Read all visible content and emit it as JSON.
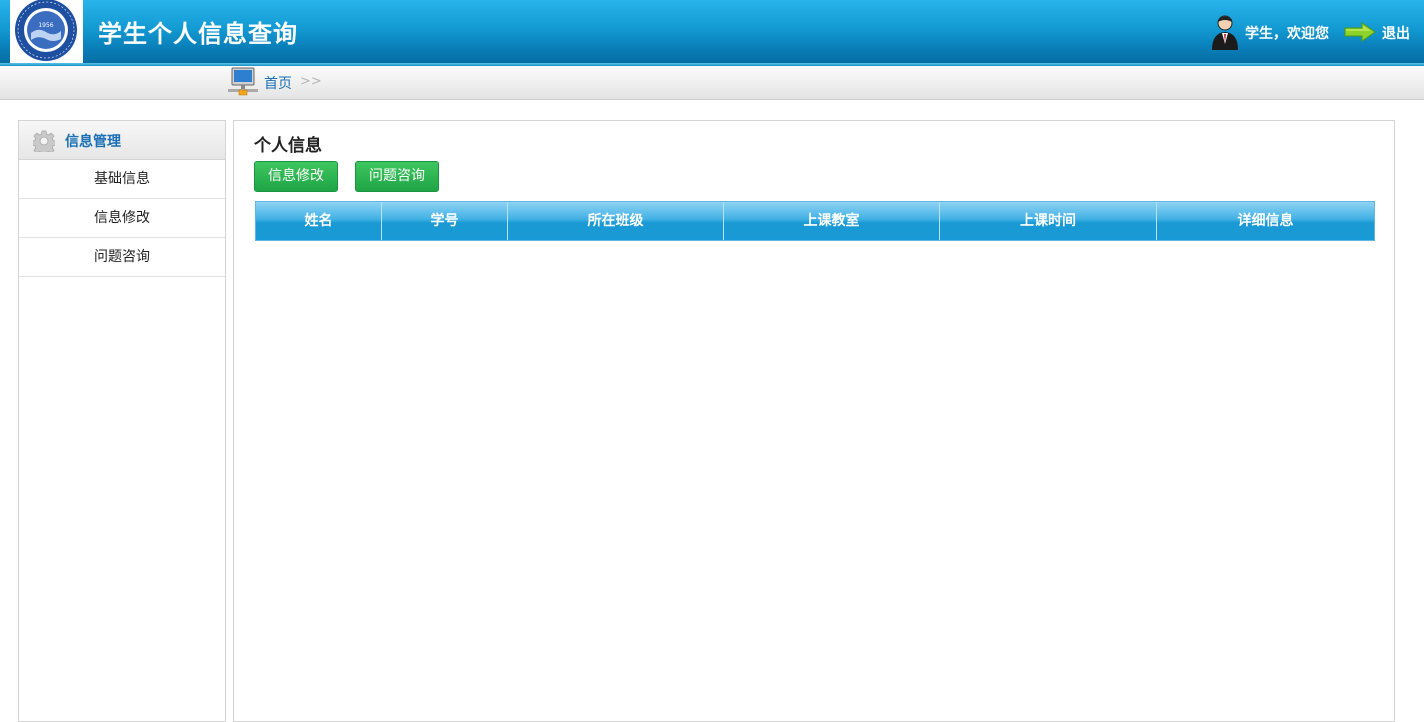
{
  "header": {
    "title": "学生个人信息查询",
    "logo_icon": "university-seal-icon",
    "welcome_text": "学生，欢迎您",
    "logout_label": "退出",
    "logo_text": "1956",
    "colors": {
      "header_blue": "#0a7fb9",
      "link_blue": "#1a6fb5",
      "button_green": "#22a94a"
    }
  },
  "breadcrumb": {
    "home": "首页",
    "separator": ">>"
  },
  "sidebar": {
    "section_title": "信息管理",
    "items": [
      {
        "label": "基础信息"
      },
      {
        "label": "信息修改"
      },
      {
        "label": "问题咨询"
      }
    ]
  },
  "main": {
    "title": "个人信息",
    "buttons": {
      "edit": "信息修改",
      "ask": "问题咨询"
    },
    "table": {
      "columns": [
        "姓名",
        "学号",
        "所在班级",
        "上课教室",
        "上课时间",
        "详细信息"
      ],
      "rows": []
    }
  }
}
